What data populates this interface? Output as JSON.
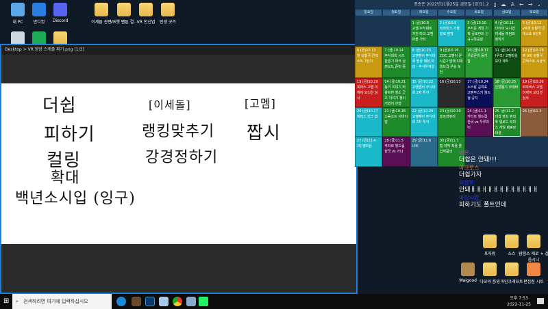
{
  "desktop": {
    "icons": [
      {
        "label": "내 PC",
        "color": "#5aa8e8"
      },
      {
        "label": "반디컷",
        "color": "#2a7ee0"
      },
      {
        "label": "Discord",
        "color": "#5865f2"
      },
      {
        "label": "이세돌 관련",
        "color": "folder"
      },
      {
        "label": "VR챗 팬툰 결...",
        "color": "folder"
      },
      {
        "label": "VR 전신법",
        "color": "folder"
      },
      {
        "label": "인생 굿즈",
        "color": "folder"
      },
      {
        "label": "",
        "color": "#cfd8e0"
      },
      {
        "label": "",
        "color": "#1faa55"
      },
      {
        "label": "",
        "color": "folder"
      }
    ],
    "right_icons": [
      {
        "label": "포자왕"
      },
      {
        "label": "소스"
      },
      {
        "label": "탐험소 제로 + 걸음시니"
      },
      {
        "label": "Waigood"
      },
      {
        "label": "다모와 음영"
      },
      {
        "label": "마인크래프트"
      },
      {
        "label": "편집점 시트"
      }
    ]
  },
  "viewer": {
    "title": "Desktop > VR 잠방 스케줄 짜기.png [1/3]",
    "handwriting": [
      "더쉽",
      "피하기",
      "컬링",
      "확대",
      "백년소시입 (잉구)",
      "[이세돌]",
      "랭킹맞추기",
      "강경정하기",
      "[고멤]",
      "짭시"
    ]
  },
  "calendar": {
    "title": "초승은 2022년11월25일 금요일 (금)11.2",
    "weekdays": [
      "일요일",
      "월요일",
      "화요일",
      "수요일",
      "목요일",
      "금요일",
      "토요일"
    ],
    "cells": [
      {
        "r": 0,
        "c": 2,
        "date": "1 (금)10.8",
        "text": "고멤 수식대회 가전 마크 고멤마을 가락",
        "color": "#1f8a2a"
      },
      {
        "r": 0,
        "c": 3,
        "date": "2 (금)10.9",
        "text": "릭마비스 가을 발로 탐방",
        "color": "#1ab8c8"
      },
      {
        "r": 0,
        "c": 4,
        "date": "3 (금)10.10",
        "text": "무서운 게임 기획 골로란트 신규구독공장",
        "color": "#1f8a2a"
      },
      {
        "r": 0,
        "c": 5,
        "date": "4 (금)10.11",
        "text": "다이어 보시겠 이세돌 퍼컴퍼 정하기",
        "color": "#1f8a2a"
      },
      {
        "r": 0,
        "c": 6,
        "date": "5 (금)10.12",
        "text": "VR챗 상황극 콘테스트 6탄차",
        "color": "#c89a12"
      },
      {
        "r": 1,
        "c": 0,
        "date": "6 (금)10.13",
        "text": "챗 상황극 콘테스트 7탄차",
        "color": "#c89a12"
      },
      {
        "r": 1,
        "c": 1,
        "date": "7 (금)10.14",
        "text": "주식대회 시즈 판결기 마크 상점모드 준비 중",
        "color": "#1f8a2a"
      },
      {
        "r": 1,
        "c": 2,
        "date": "8 (금)10.15",
        "text": "고멤멤버 주식대회 명상 채용 마감 - 주식투자일",
        "color": "#1ab8c8"
      },
      {
        "r": 1,
        "c": 3,
        "date": "9 (금)10.16",
        "text": "CDC 고멤이 몬 시즌2 발매 피파 월드컵 우승 도전",
        "color": "#1f8a2a"
      },
      {
        "r": 1,
        "c": 4,
        "date": "10 (금)10.17",
        "text": "우왁굳의 동거 합",
        "color": "#2a9a35"
      },
      {
        "r": 1,
        "c": 5,
        "date": "11 (금)10.18",
        "text": "(우크) 고멤마을 모다 제작",
        "color": "#0e4d12"
      },
      {
        "r": 1,
        "c": 6,
        "date": "12 (금)10.19",
        "text": "제 9회 상황극 콘테스트 시상식",
        "color": "#c89a12"
      },
      {
        "r": 2,
        "c": 0,
        "date": "13 (금)10.20",
        "text": "피마스 고멤 이케어 오디션 심사",
        "color": "#c81e1e"
      },
      {
        "r": 2,
        "c": 1,
        "date": "14 (금)10.21",
        "text": "동거 이야기 마왕퇴면 청소 굿즈 이야기 챙이거였어 인형",
        "color": "#1f8a2a"
      },
      {
        "r": 2,
        "c": 2,
        "date": "15 (금)10.22",
        "text": "고멤멤버 주식대회 2차 투자",
        "color": "#1ab8c8"
      },
      {
        "r": 2,
        "c": 3,
        "date": "16 (금)10.23",
        "text": "",
        "color": "#2a2a2a"
      },
      {
        "r": 2,
        "c": 4,
        "date": "17 (금)10.24",
        "text": "소스랑 공여표 고멘무스키 월드컵 공지",
        "color": "#0a0f5a"
      },
      {
        "r": 2,
        "c": 5,
        "date": "18 (금)10.25",
        "text": "인형뽑기 코레바",
        "color": "#2a9a35"
      },
      {
        "r": 2,
        "c": 6,
        "date": "19 (금)10.26",
        "text": "릭마비스 고멤 이케어 오디션 심사",
        "color": "#c81e1e"
      },
      {
        "r": 3,
        "c": 0,
        "date": "20 (금)10.27",
        "text": "피마스 마크 합",
        "color": "#1ab8c8"
      },
      {
        "r": 3,
        "c": 1,
        "date": "21 (금)10.28",
        "text": "소음소트 서바이벌",
        "color": "#1f8a2a"
      },
      {
        "r": 3,
        "c": 2,
        "date": "22 (금)10.29",
        "text": "고멤멤버 주식대회 3차 투자",
        "color": "#1ab8c8"
      },
      {
        "r": 3,
        "c": 3,
        "date": "23 (금)10.30",
        "text": "놀프래쥬리",
        "color": "#1f8a2a"
      },
      {
        "r": 3,
        "c": 4,
        "date": "24 (금)11.1",
        "text": "카타르 월드컵 한국 vs 우루과이",
        "color": "#5a0f55"
      },
      {
        "r": 3,
        "c": 5,
        "date": "25 (금)11.2",
        "text": "더쉽 영상 편집후 업로드 릭마스 게임 캠핑장 대결",
        "color": "#1f8a2a"
      },
      {
        "r": 3,
        "c": 6,
        "date": "26 (금)11.3",
        "text": "",
        "color": "#8a5a3a"
      },
      {
        "r": 4,
        "c": 0,
        "date": "27 (금)11.4",
        "text": "크] 멤좌음",
        "color": "#1ab8c8"
      },
      {
        "r": 4,
        "c": 1,
        "date": "28 (금)11.5",
        "text": "카타르 월드컵 한국 vs 가나",
        "color": "#5a0f55"
      },
      {
        "r": 4,
        "c": 2,
        "date": "29 (금)11.6",
        "text": "나비",
        "color": "#2a6a8a"
      },
      {
        "r": 4,
        "c": 3,
        "date": "30 (금)11.7",
        "text": "랩 제작 착용 졸업작품의",
        "color": "#1f8a2a"
      }
    ]
  },
  "chat": [
    {
      "name": "네온",
      "msg": "더쉽은 안돼!!!",
      "color": "#9a5aa0"
    },
    {
      "name": "아크로스",
      "msg": "더쉽가자",
      "color": "#e87a2a"
    },
    {
      "name": "의장학",
      "msg": "안돼ㅐㅐㅐㅐㅐㅐㅐㅐㅐㅐㅐㅐ",
      "color": "#2a3ae8"
    },
    {
      "name": "아랑사랑_",
      "msg": "피하기도 폴트인데",
      "color": "#2a3ae8"
    }
  ],
  "taskbar": {
    "search_placeholder": "검색하려면 여기에 입력하십시오",
    "time": "오후 7:53",
    "date": "2022-11-25"
  }
}
